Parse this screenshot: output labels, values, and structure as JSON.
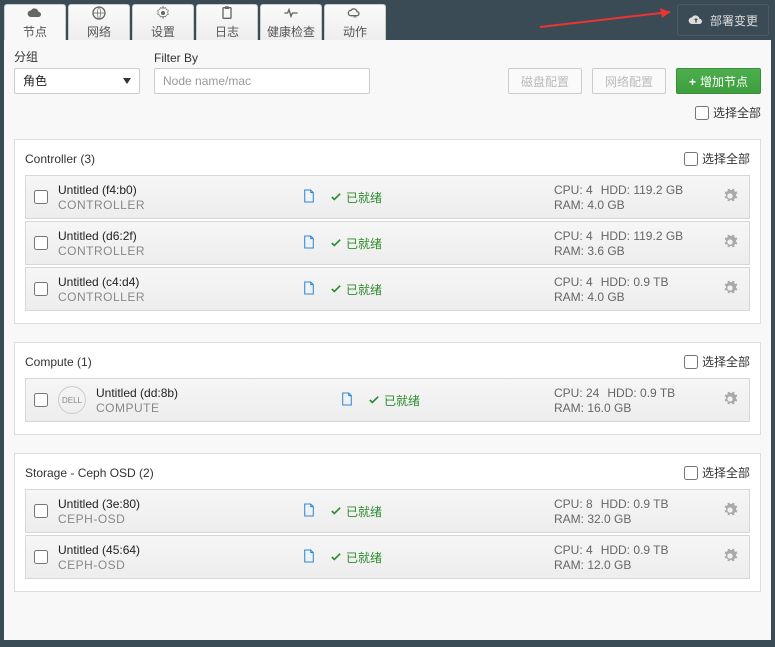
{
  "tabs": [
    {
      "id": "nodes",
      "label": "节点"
    },
    {
      "id": "network",
      "label": "网络"
    },
    {
      "id": "settings",
      "label": "设置"
    },
    {
      "id": "logs",
      "label": "日志"
    },
    {
      "id": "health",
      "label": "健康检查"
    },
    {
      "id": "actions",
      "label": "动作"
    }
  ],
  "deploy": {
    "label": "部署变更"
  },
  "filters": {
    "group_label": "分组",
    "group_value": "角色",
    "filter_label": "Filter By",
    "filter_placeholder": "Node name/mac"
  },
  "buttons": {
    "disk": "磁盘配置",
    "net": "网络配置",
    "add": "增加节点",
    "select_all": "选择全部"
  },
  "groups": [
    {
      "title": "Controller (3)",
      "nodes_key": "controller",
      "has_logo": false
    },
    {
      "title": "Compute (1)",
      "nodes_key": "compute",
      "has_logo": true
    },
    {
      "title": "Storage - Ceph OSD (2)",
      "nodes_key": "storage",
      "has_logo": false
    }
  ],
  "nodes": {
    "controller": [
      {
        "name": "Untitled (f4:b0)",
        "role": "CONTROLLER",
        "status": "已就绪",
        "cpu": "CPU: 4",
        "hdd": "HDD: 119.2 GB",
        "ram": "RAM: 4.0 GB"
      },
      {
        "name": "Untitled (d6:2f)",
        "role": "CONTROLLER",
        "status": "已就绪",
        "cpu": "CPU: 4",
        "hdd": "HDD: 119.2 GB",
        "ram": "RAM: 3.6 GB"
      },
      {
        "name": "Untitled (c4:d4)",
        "role": "CONTROLLER",
        "status": "已就绪",
        "cpu": "CPU: 4",
        "hdd": "HDD: 0.9 TB",
        "ram": "RAM: 4.0 GB"
      }
    ],
    "compute": [
      {
        "name": "Untitled (dd:8b)",
        "role": "COMPUTE",
        "status": "已就绪",
        "cpu": "CPU: 24",
        "hdd": "HDD: 0.9 TB",
        "ram": "RAM: 16.0 GB"
      }
    ],
    "storage": [
      {
        "name": "Untitled (3e:80)",
        "role": "CEPH-OSD",
        "status": "已就绪",
        "cpu": "CPU: 8",
        "hdd": "HDD: 0.9 TB",
        "ram": "RAM: 32.0 GB"
      },
      {
        "name": "Untitled (45:64)",
        "role": "CEPH-OSD",
        "status": "已就绪",
        "cpu": "CPU: 4",
        "hdd": "HDD: 0.9 TB",
        "ram": "RAM: 12.0 GB"
      }
    ]
  }
}
